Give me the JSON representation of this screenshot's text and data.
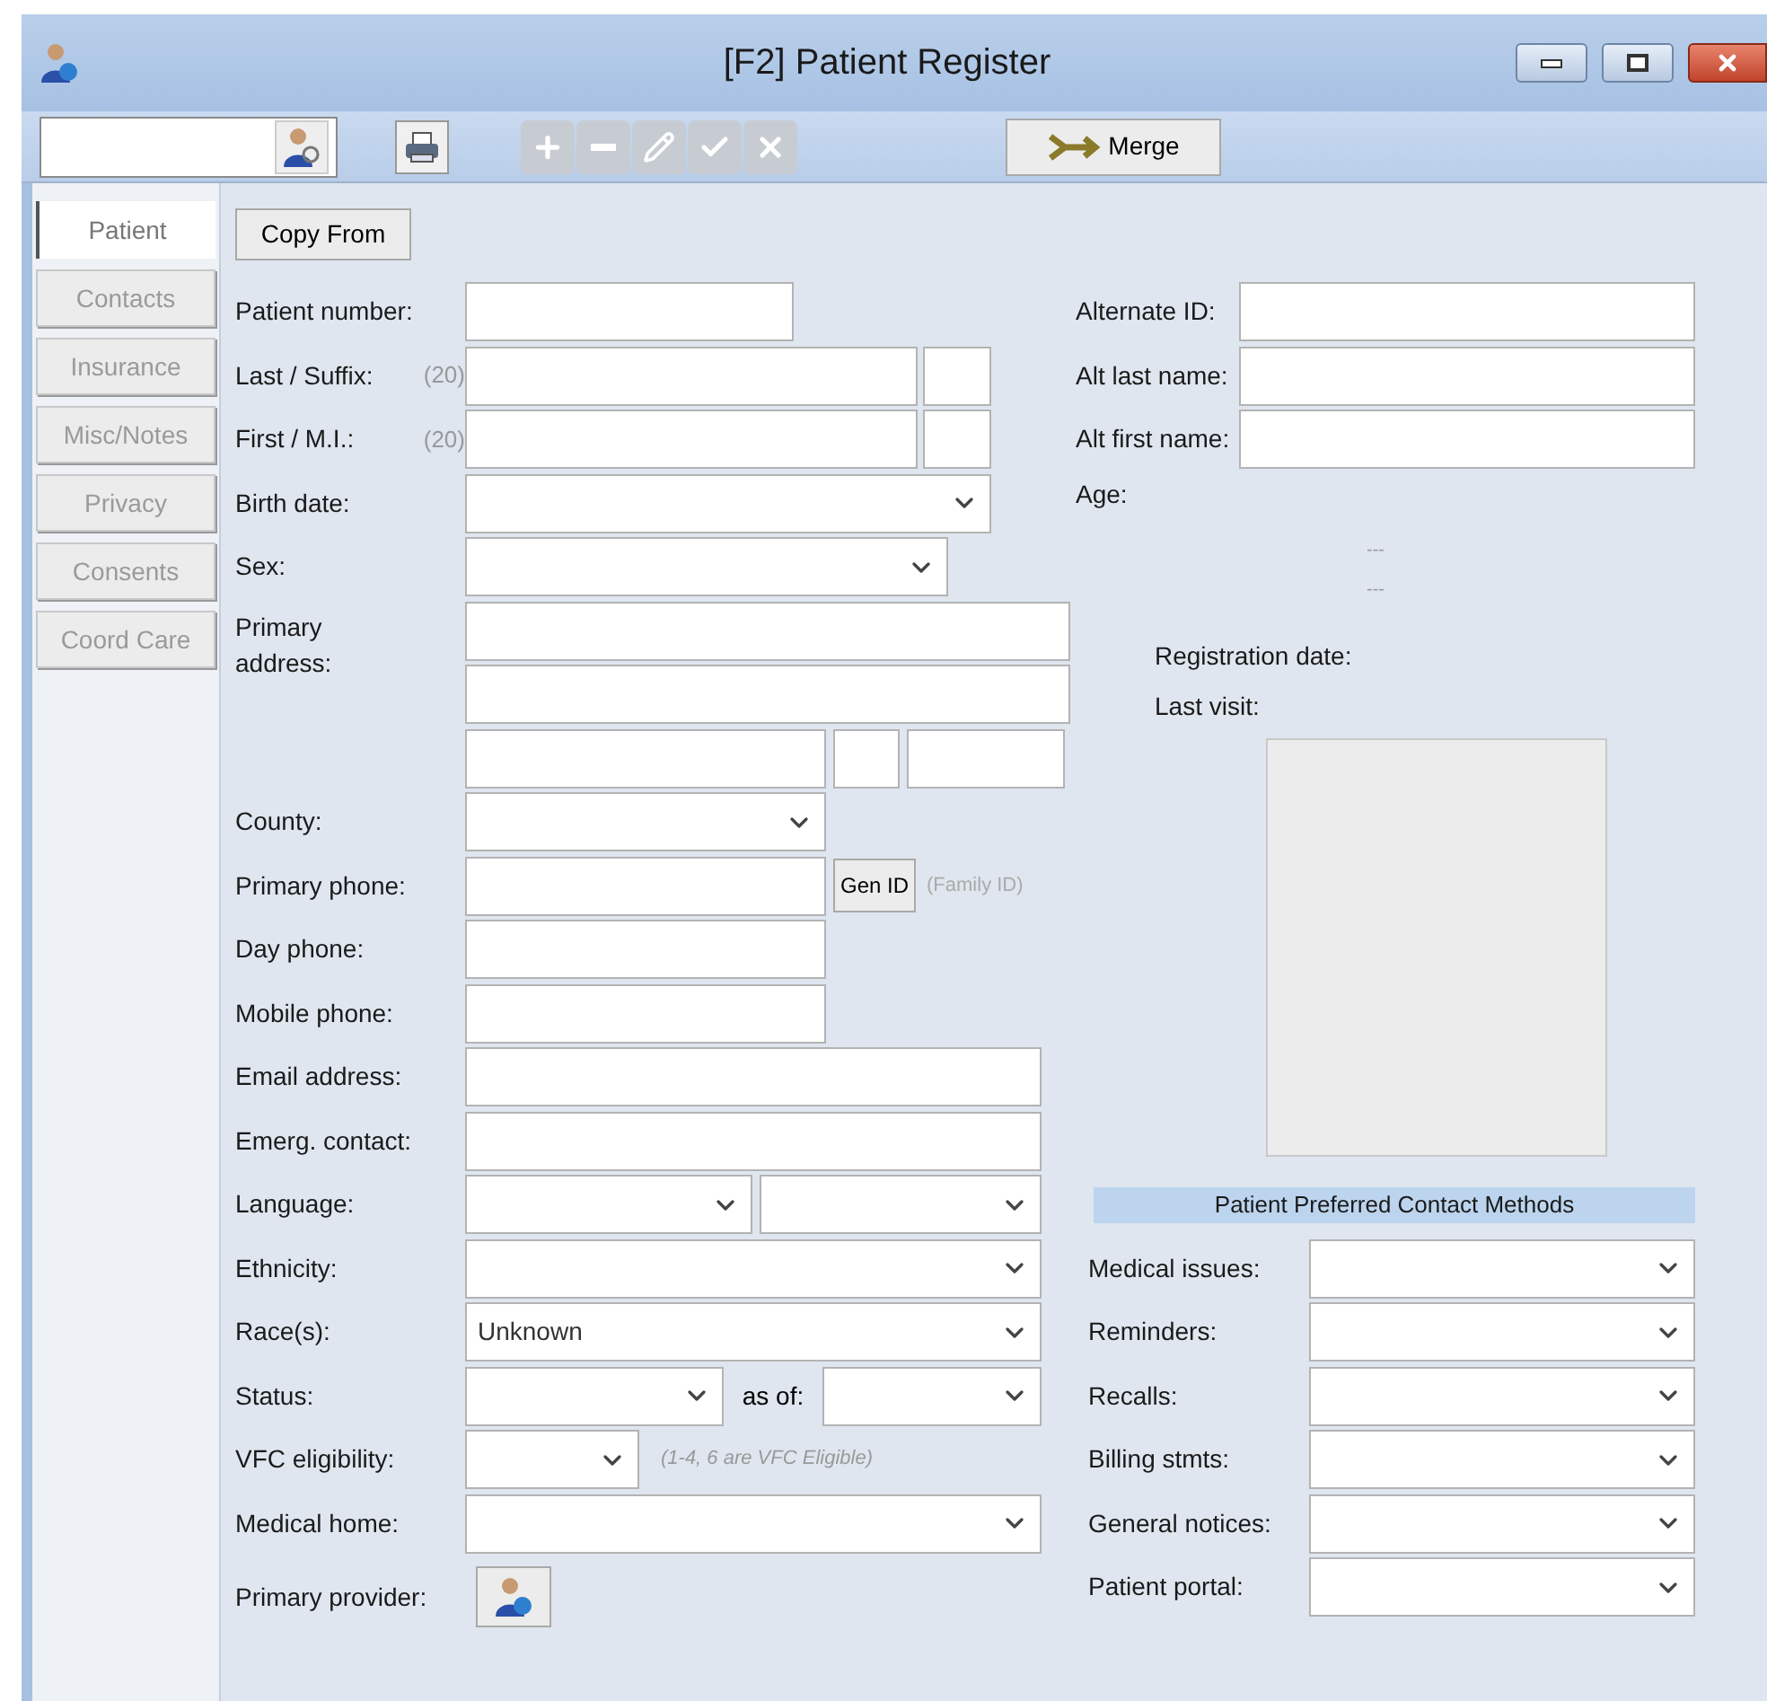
{
  "window": {
    "title": "[F2] Patient Register"
  },
  "toolbar": {
    "buttons": [
      {
        "kind": "print",
        "disabled": false
      },
      {
        "kind": "add",
        "disabled": true
      },
      {
        "kind": "remove",
        "disabled": true
      },
      {
        "kind": "edit",
        "disabled": true
      },
      {
        "kind": "accept",
        "disabled": true
      },
      {
        "kind": "cancel",
        "disabled": true
      }
    ],
    "merge_button": {
      "label": "Merge"
    }
  },
  "side_tabs": [
    {
      "label": "Patient",
      "selected": true
    },
    {
      "label": "Contacts",
      "selected": false
    },
    {
      "label": "Insurance",
      "selected": false
    },
    {
      "label": "Misc/Notes",
      "selected": false
    },
    {
      "label": "Privacy",
      "selected": false
    },
    {
      "label": "Consents",
      "selected": false
    },
    {
      "label": "Coord Care",
      "selected": false
    }
  ],
  "copy_from_button": {
    "label": "Copy From"
  },
  "left_form": {
    "patient_number": {
      "label": "Patient number:"
    },
    "last_suffix": {
      "label": "Last / Suffix:",
      "hint": "(20)"
    },
    "first_mi": {
      "label": "First / M.I.:",
      "hint": "(20)"
    },
    "birth_date": {
      "label": "Birth date:"
    },
    "sex": {
      "label": "Sex:"
    },
    "primary_address": {
      "label": "Primary address:"
    },
    "county": {
      "label": "County:"
    },
    "primary_phone": {
      "label": "Primary phone:",
      "button": "Gen ID",
      "note": "(Family ID)"
    },
    "day_phone": {
      "label": "Day phone:"
    },
    "mobile_phone": {
      "label": "Mobile phone:"
    },
    "email_address": {
      "label": "Email address:"
    },
    "emerg_contact": {
      "label": "Emerg. contact:"
    },
    "language": {
      "label": "Language:"
    },
    "ethnicity": {
      "label": "Ethnicity:"
    },
    "races": {
      "label": "Race(s):",
      "value": "Unknown"
    },
    "status": {
      "label": "Status:",
      "as_of_label": "as of:"
    },
    "vfc_eligibility": {
      "label": "VFC eligibility:",
      "note": "(1-4, 6 are VFC Eligible)"
    },
    "medical_home": {
      "label": "Medical home:"
    },
    "primary_provider": {
      "label": "Primary provider:"
    }
  },
  "right_form": {
    "alternate_id": {
      "label": "Alternate ID:"
    },
    "alt_last_name": {
      "label": "Alt last name:"
    },
    "alt_first_name": {
      "label": "Alt first name:"
    },
    "age": {
      "label": "Age:"
    },
    "dashes": [
      "---",
      "---"
    ],
    "registration_date": {
      "label": "Registration date:"
    },
    "last_visit": {
      "label": "Last visit:"
    }
  },
  "contact_methods": {
    "title": "Patient Preferred Contact Methods",
    "rows": [
      {
        "label": "Medical issues:"
      },
      {
        "label": "Reminders:"
      },
      {
        "label": "Recalls:"
      },
      {
        "label": "Billing stmts:"
      },
      {
        "label": "General notices:"
      },
      {
        "label": "Patient portal:"
      }
    ]
  }
}
